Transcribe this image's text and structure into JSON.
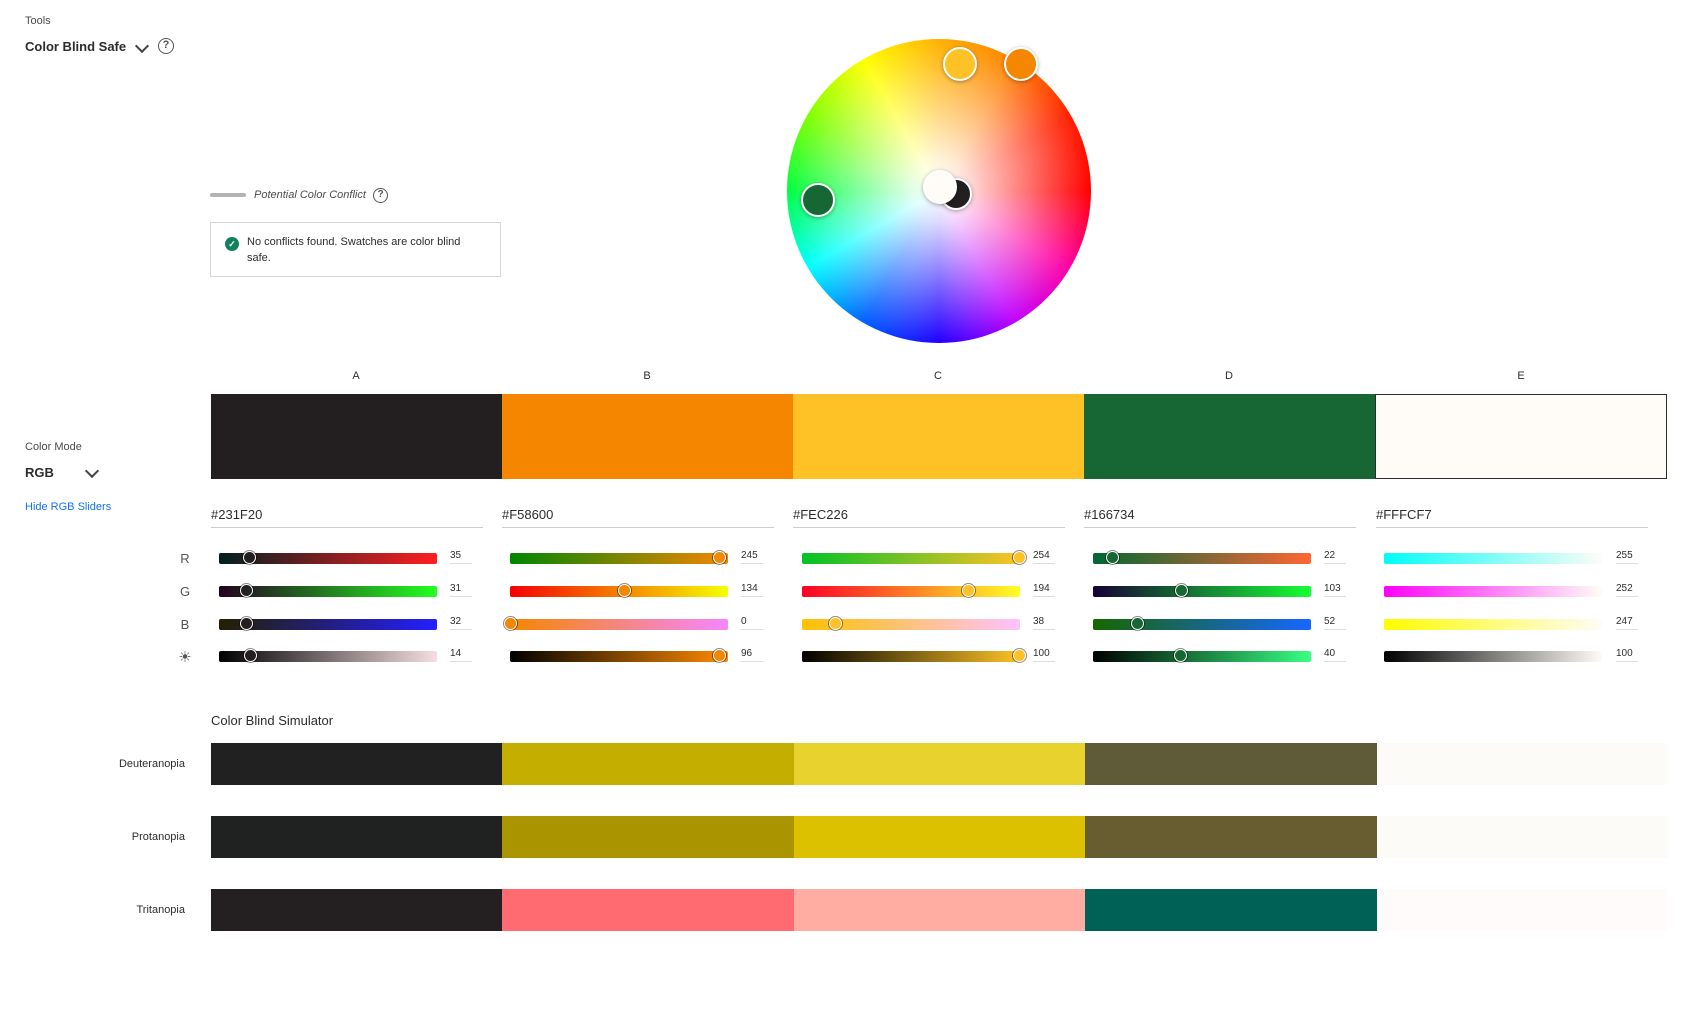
{
  "tools": {
    "label": "Tools",
    "selected": "Color Blind Safe"
  },
  "conflict": {
    "legend": "Potential Color Conflict",
    "message": "No conflicts found. Swatches are color blind safe."
  },
  "color_mode": {
    "label": "Color Mode",
    "value": "RGB",
    "toggle_link": "Hide RGB Sliders"
  },
  "columns": [
    "A",
    "B",
    "C",
    "D",
    "E"
  ],
  "channel_labels": [
    "R",
    "G",
    "B"
  ],
  "swatches": [
    {
      "hex": "#231F20",
      "color": "#231F20",
      "r": "35",
      "g": "31",
      "b": "32",
      "br": "14"
    },
    {
      "hex": "#F58600",
      "color": "#F58600",
      "r": "245",
      "g": "134",
      "b": "0",
      "br": "96"
    },
    {
      "hex": "#FEC226",
      "color": "#FEC226",
      "r": "254",
      "g": "194",
      "b": "38",
      "br": "100"
    },
    {
      "hex": "#166734",
      "color": "#166734",
      "r": "22",
      "g": "103",
      "b": "52",
      "br": "40"
    },
    {
      "hex": "#FFFCF7",
      "color": "#FFFCF7",
      "r": "255",
      "g": "252",
      "b": "247",
      "br": "100"
    }
  ],
  "simulator": {
    "title": "Color Blind Simulator",
    "rows": [
      {
        "label": "Deuteranopia",
        "colors": [
          "#212121",
          "#C4AF00",
          "#E8D22E",
          "#5F5A38",
          "#FCFBF7"
        ]
      },
      {
        "label": "Protanopia",
        "colors": [
          "#202222",
          "#AA9500",
          "#DCC100",
          "#675D31",
          "#FCFBF7"
        ]
      },
      {
        "label": "Tritanopia",
        "colors": [
          "#241F20",
          "#FF6B71",
          "#FFACA2",
          "#006257",
          "#FFFBFA"
        ]
      }
    ]
  }
}
